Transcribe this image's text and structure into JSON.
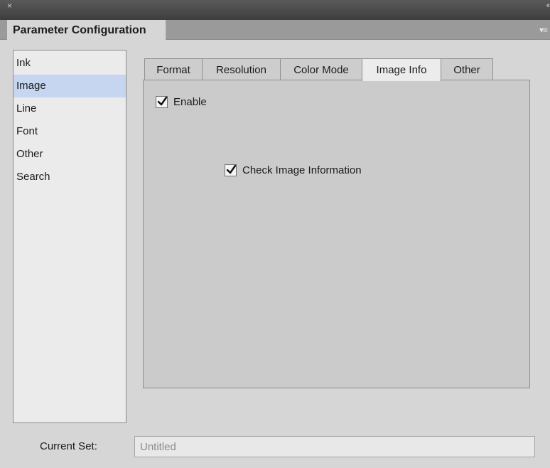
{
  "window": {
    "close_glyph": "×",
    "collapse_glyph": "‹‹"
  },
  "panel": {
    "title": "Parameter Configuration",
    "menu_glyph": "▾≡"
  },
  "categories": [
    {
      "label": "Ink",
      "selected": false
    },
    {
      "label": "Image",
      "selected": true
    },
    {
      "label": "Line",
      "selected": false
    },
    {
      "label": "Font",
      "selected": false
    },
    {
      "label": "Other",
      "selected": false
    },
    {
      "label": "Search",
      "selected": false
    }
  ],
  "tabs": [
    {
      "label": "Format",
      "active": false
    },
    {
      "label": "Resolution",
      "active": false
    },
    {
      "label": "Color Mode",
      "active": false
    },
    {
      "label": "Image Info",
      "active": true
    },
    {
      "label": "Other",
      "active": false
    }
  ],
  "options": {
    "enable": {
      "label": "Enable",
      "checked": true
    },
    "check_image_info": {
      "label": "Check Image Information",
      "checked": true
    }
  },
  "footer": {
    "current_set_label": "Current Set:",
    "current_set_placeholder": "Untitled",
    "current_set_value": ""
  },
  "colors": {
    "selected_item": "#c6d6f0",
    "panel_bg": "#d6d6d6",
    "titlebar": "#4a4a4a"
  }
}
